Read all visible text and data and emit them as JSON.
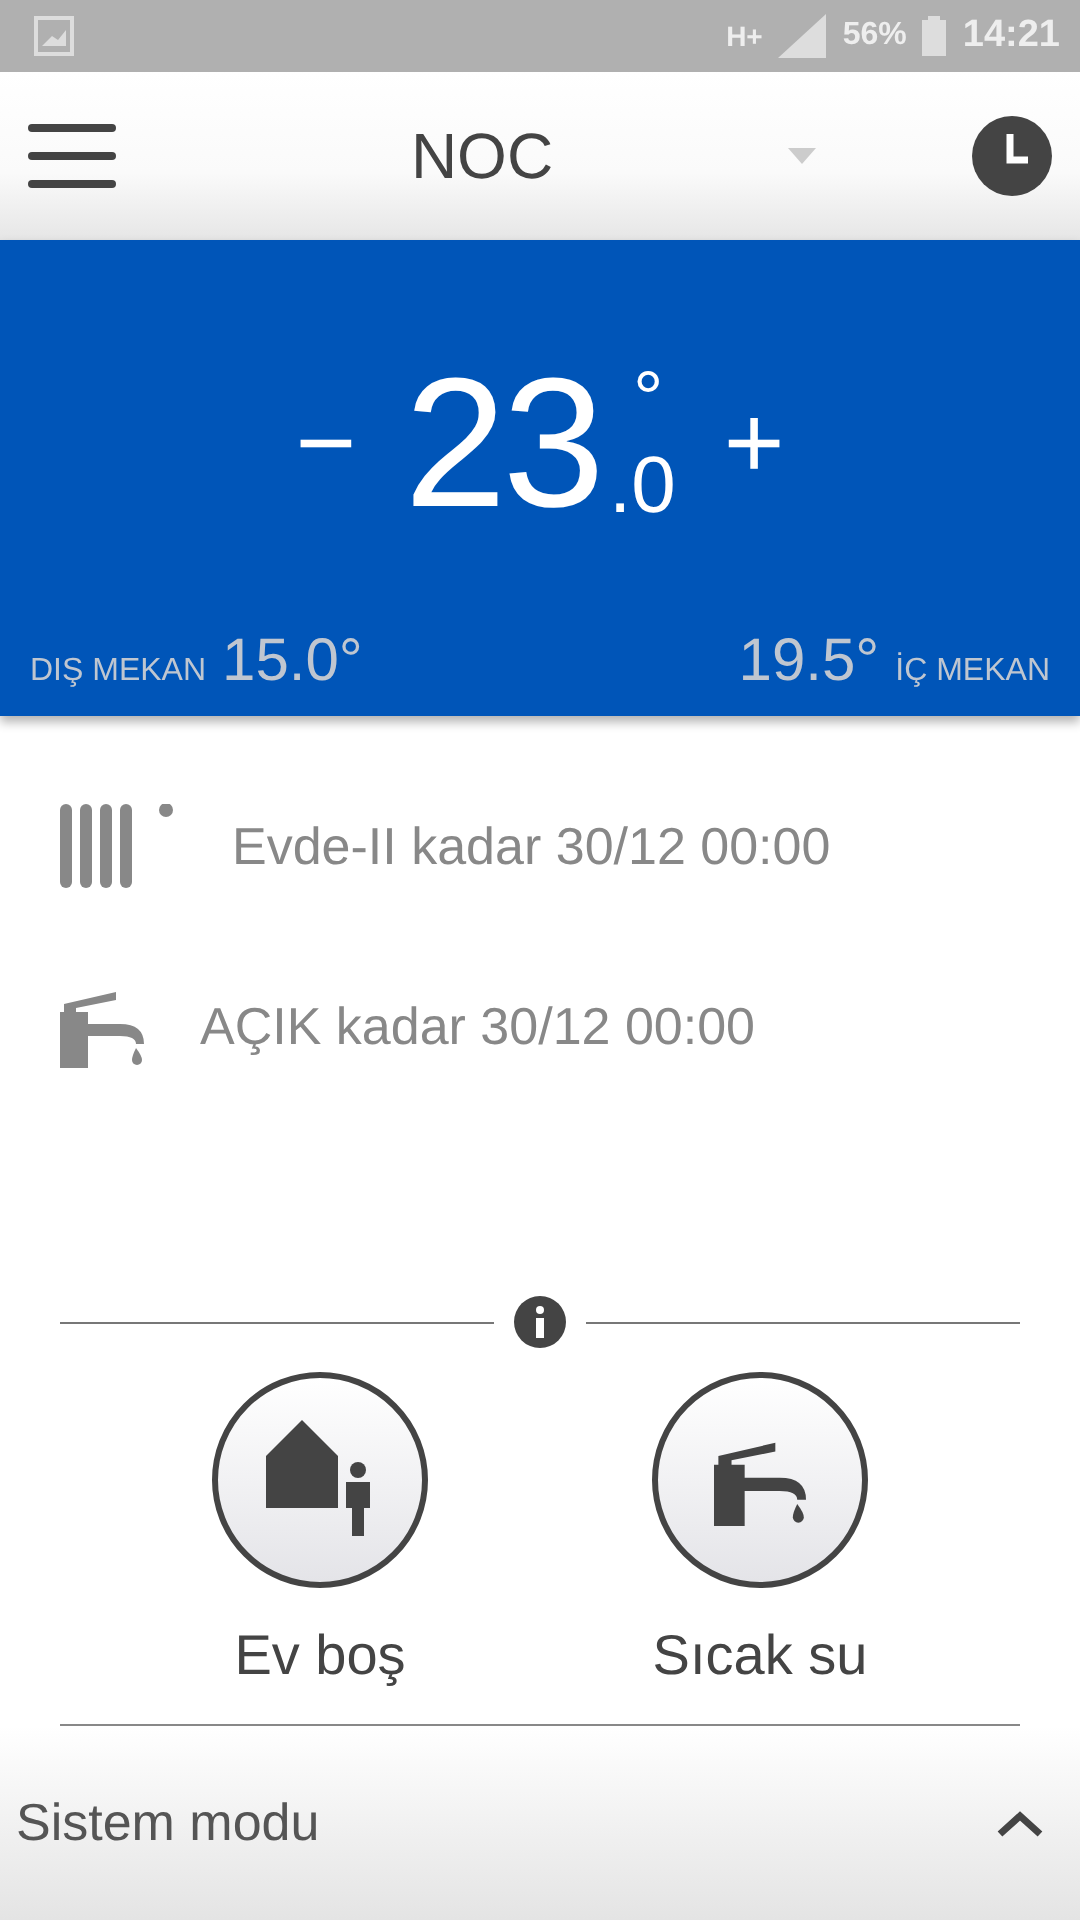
{
  "status_bar": {
    "network": "H+",
    "battery": "56%",
    "time": "14:21"
  },
  "header": {
    "title": "NOC"
  },
  "setpoint": {
    "minus": "−",
    "whole": "23",
    "decimal": ".0",
    "degree": "°",
    "plus": "+"
  },
  "outdoor": {
    "label": "DIŞ MEKAN",
    "value": "15.0°"
  },
  "indoor": {
    "value": "19.5°",
    "label": "İÇ MEKAN"
  },
  "schedules": [
    {
      "kind": "heating",
      "text": "Evde-II kadar 30/12 00:00"
    },
    {
      "kind": "hot_water",
      "text": "AÇIK kadar 30/12 00:00"
    }
  ],
  "actions": [
    {
      "kind": "away",
      "label": "Ev boş"
    },
    {
      "kind": "hot_water",
      "label": "Sıcak su"
    }
  ],
  "footer": {
    "label": "Sistem modu"
  }
}
